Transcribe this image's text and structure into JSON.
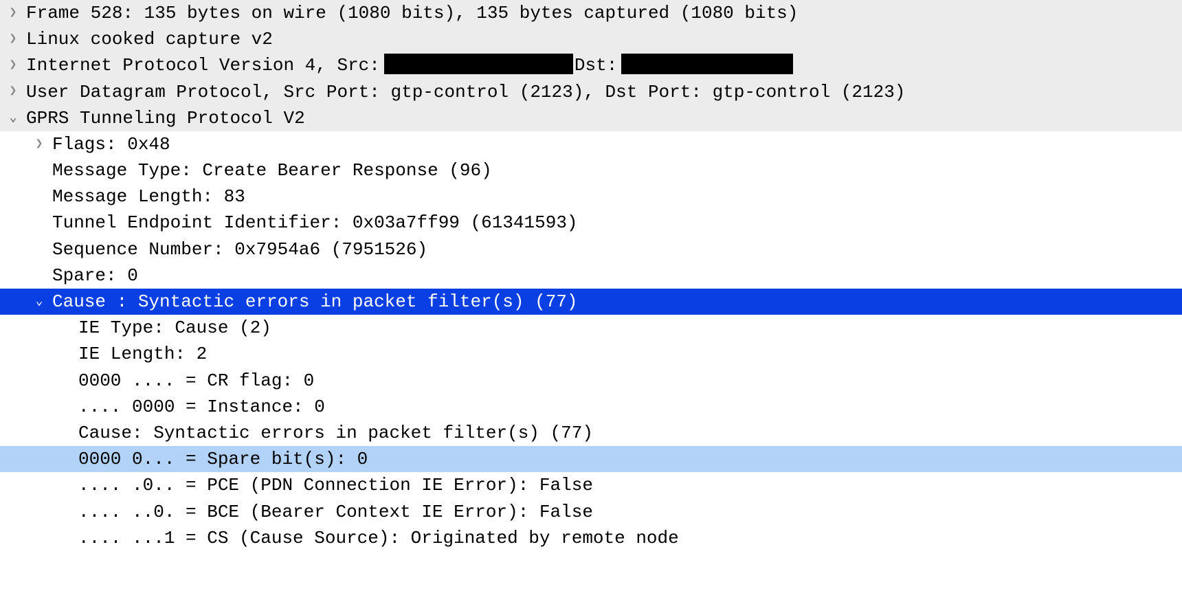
{
  "top": {
    "frame": "Frame 528: 135 bytes on wire (1080 bits), 135 bytes captured (1080 bits)",
    "linux": "Linux cooked capture v2",
    "ip_pre": "Internet Protocol Version 4, Src:",
    "ip_dst": "Dst:",
    "udp": "User Datagram Protocol, Src Port: gtp-control (2123), Dst Port: gtp-control (2123)",
    "gprs": "GPRS Tunneling Protocol V2"
  },
  "g": {
    "flags": "Flags: 0x48",
    "msg_type": "Message Type: Create Bearer Response (96)",
    "msg_len": "Message Length: 83",
    "teid": "Tunnel Endpoint Identifier: 0x03a7ff99 (61341593)",
    "seq": "Sequence Number: 0x7954a6 (7951526)",
    "spare": "Spare: 0",
    "cause_hdr": "Cause : Syntactic errors in packet filter(s) (77)"
  },
  "c": {
    "ie_type": "IE Type: Cause (2)",
    "ie_len": "IE Length: 2",
    "cr_flag": "0000 .... = CR flag: 0",
    "inst": ".... 0000 = Instance: 0",
    "cause": "Cause: Syntactic errors in packet filter(s) (77)",
    "spare_bits": "0000 0... = Spare bit(s): 0",
    "pce": ".... .0.. = PCE (PDN Connection IE Error): False",
    "bce": ".... ..0. = BCE (Bearer Context IE Error): False",
    "cs": ".... ...1 = CS (Cause Source): Originated by remote node"
  }
}
